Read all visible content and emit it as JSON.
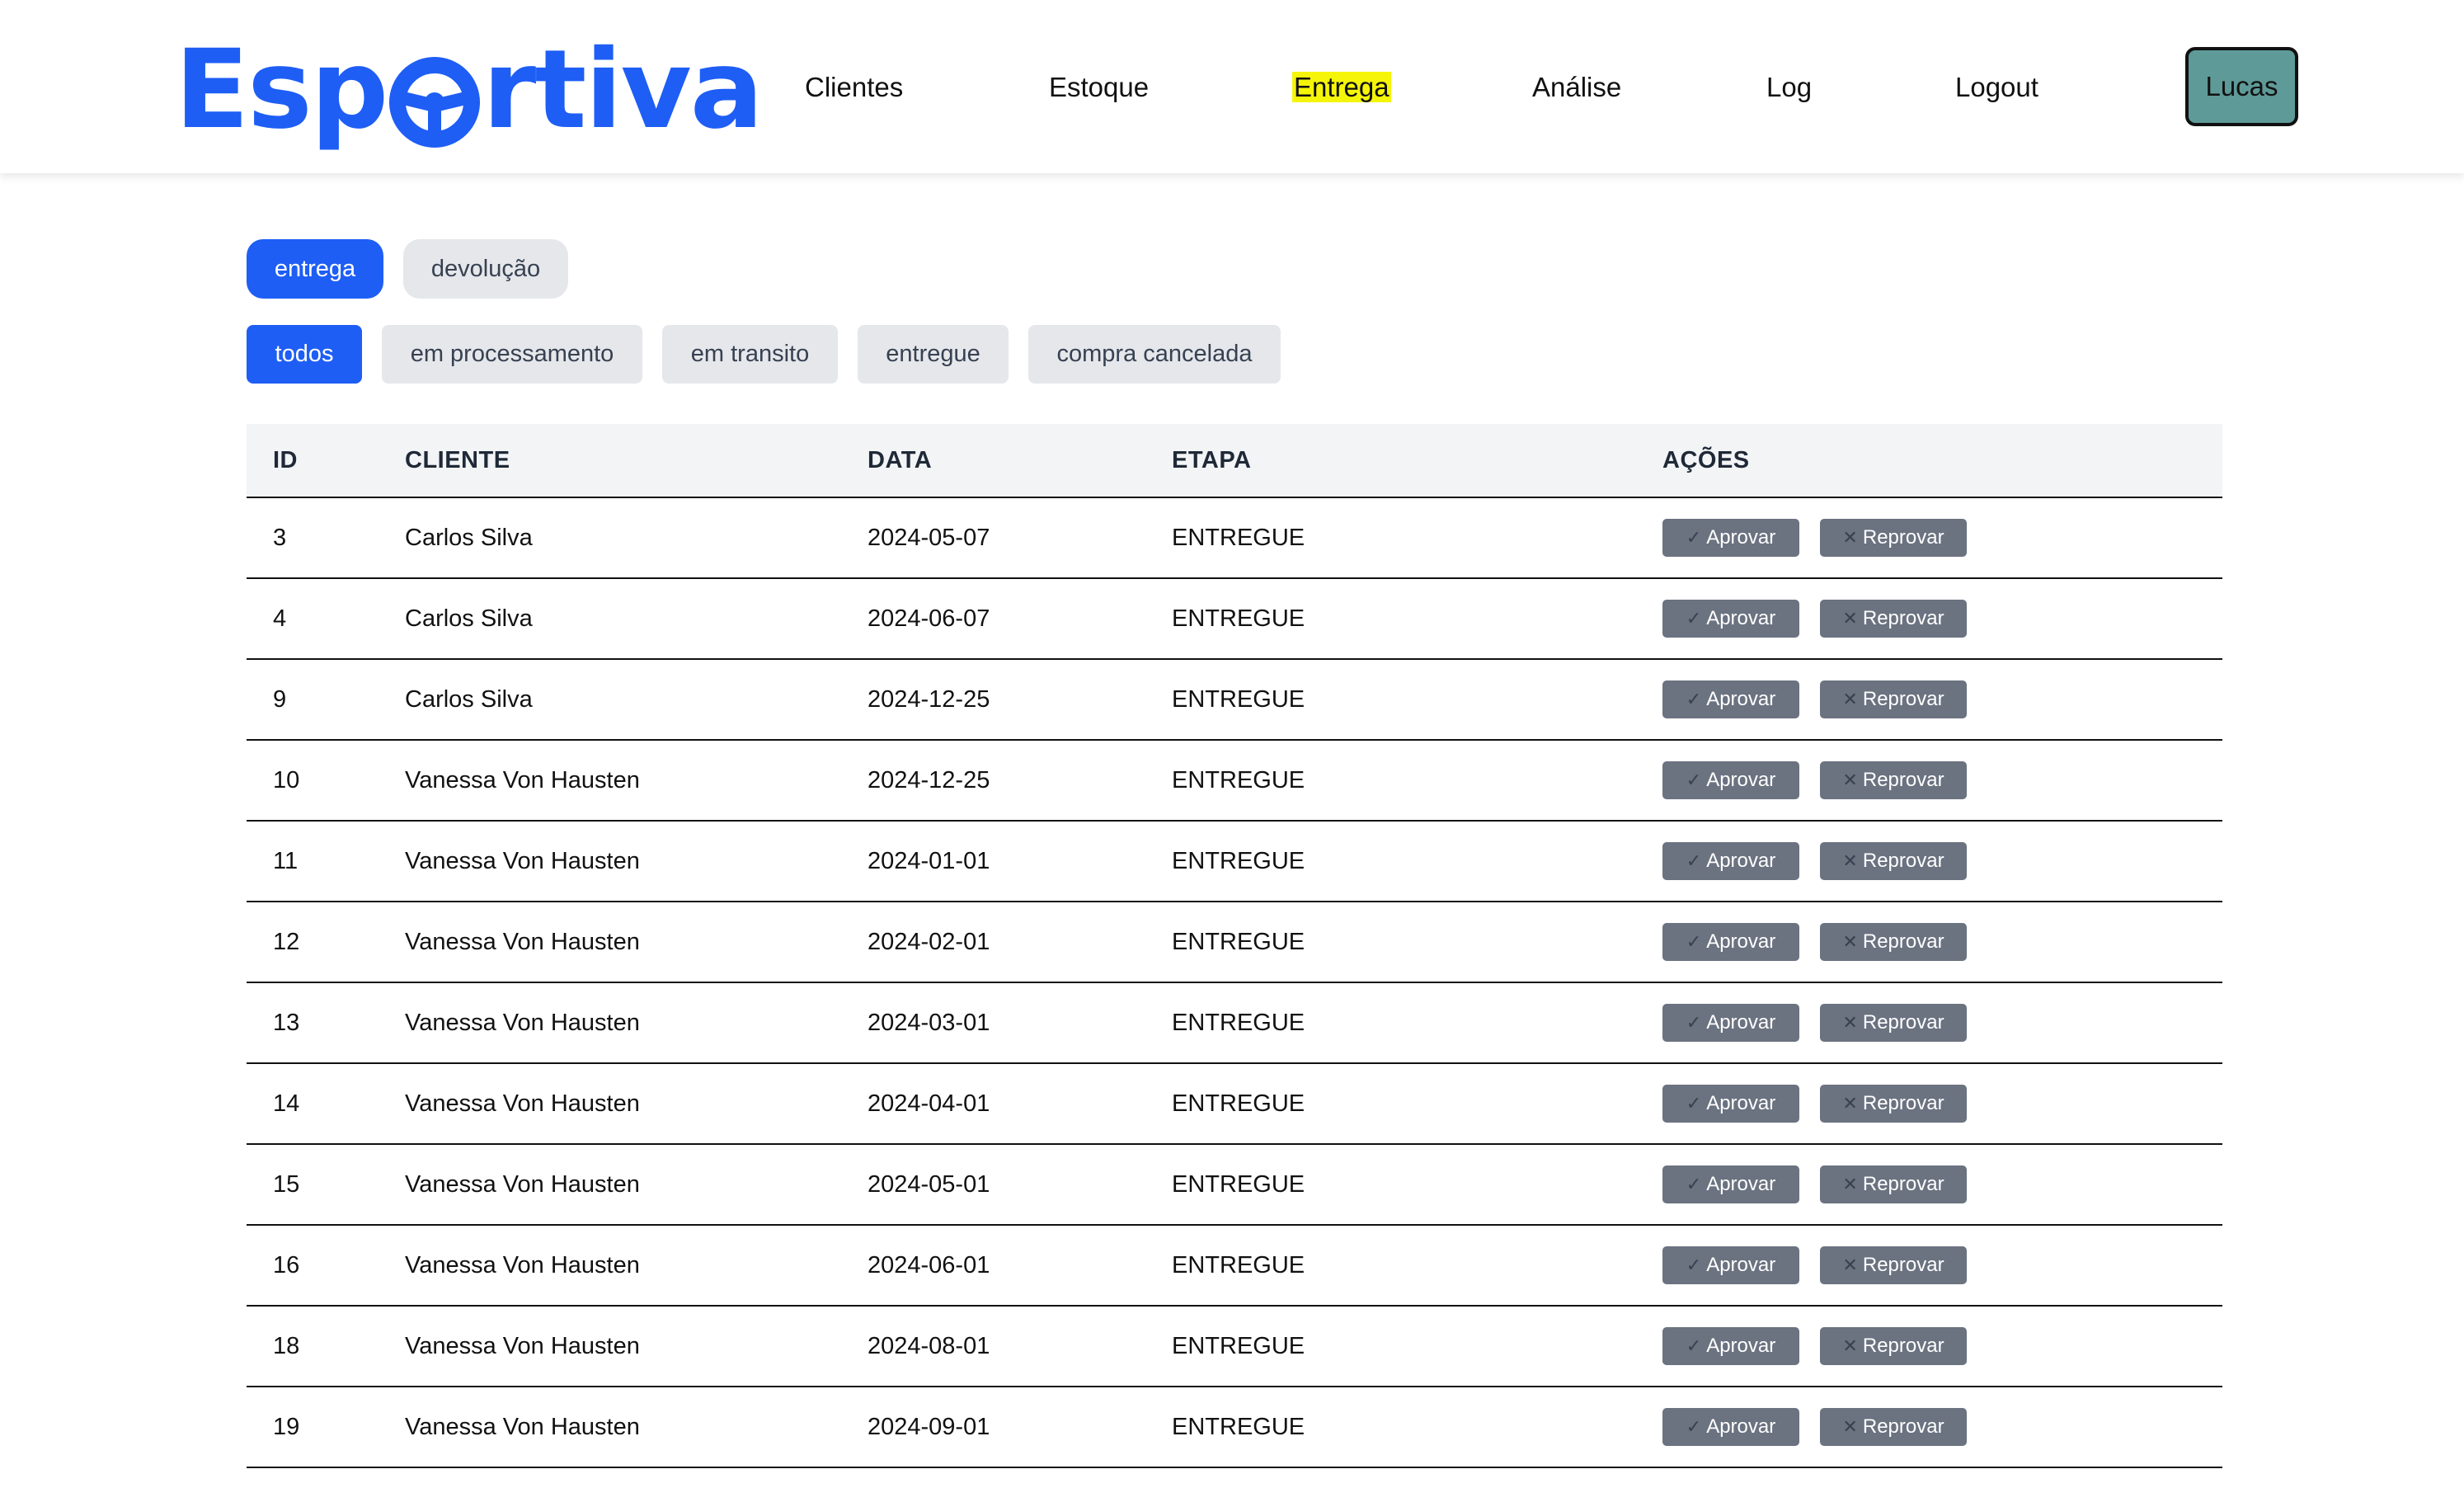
{
  "brand": {
    "logo_left": "Esp",
    "logo_right": "rtiva",
    "color": "#1e5ef5"
  },
  "nav": {
    "items": [
      {
        "label": "Clientes",
        "active": false
      },
      {
        "label": "Estoque",
        "active": false
      },
      {
        "label": "Entrega",
        "active": true
      },
      {
        "label": "Análise",
        "active": false
      },
      {
        "label": "Log",
        "active": false
      },
      {
        "label": "Logout",
        "active": false
      }
    ],
    "user_label": "Lucas"
  },
  "type_tabs": [
    {
      "label": "entrega",
      "active": true
    },
    {
      "label": "devolução",
      "active": false
    }
  ],
  "status_filters": [
    {
      "label": "todos",
      "active": true
    },
    {
      "label": "em processamento",
      "active": false
    },
    {
      "label": "em transito",
      "active": false
    },
    {
      "label": "entregue",
      "active": false
    },
    {
      "label": "compra cancelada",
      "active": false
    }
  ],
  "table": {
    "headers": {
      "id": "ID",
      "cliente": "CLIENTE",
      "data": "DATA",
      "etapa": "ETAPA",
      "acoes": "AÇÕES"
    },
    "approve_label": "Aprovar",
    "reject_label": "Reprovar",
    "approve_icon": "check-icon",
    "reject_icon": "x-icon",
    "rows": [
      {
        "id": "3",
        "cliente": "Carlos Silva",
        "data": "2024-05-07",
        "etapa": "ENTREGUE"
      },
      {
        "id": "4",
        "cliente": "Carlos Silva",
        "data": "2024-06-07",
        "etapa": "ENTREGUE"
      },
      {
        "id": "9",
        "cliente": "Carlos Silva",
        "data": "2024-12-25",
        "etapa": "ENTREGUE"
      },
      {
        "id": "10",
        "cliente": "Vanessa Von Hausten",
        "data": "2024-12-25",
        "etapa": "ENTREGUE"
      },
      {
        "id": "11",
        "cliente": "Vanessa Von Hausten",
        "data": "2024-01-01",
        "etapa": "ENTREGUE"
      },
      {
        "id": "12",
        "cliente": "Vanessa Von Hausten",
        "data": "2024-02-01",
        "etapa": "ENTREGUE"
      },
      {
        "id": "13",
        "cliente": "Vanessa Von Hausten",
        "data": "2024-03-01",
        "etapa": "ENTREGUE"
      },
      {
        "id": "14",
        "cliente": "Vanessa Von Hausten",
        "data": "2024-04-01",
        "etapa": "ENTREGUE"
      },
      {
        "id": "15",
        "cliente": "Vanessa Von Hausten",
        "data": "2024-05-01",
        "etapa": "ENTREGUE"
      },
      {
        "id": "16",
        "cliente": "Vanessa Von Hausten",
        "data": "2024-06-01",
        "etapa": "ENTREGUE"
      },
      {
        "id": "18",
        "cliente": "Vanessa Von Hausten",
        "data": "2024-08-01",
        "etapa": "ENTREGUE"
      },
      {
        "id": "19",
        "cliente": "Vanessa Von Hausten",
        "data": "2024-09-01",
        "etapa": "ENTREGUE"
      }
    ]
  }
}
